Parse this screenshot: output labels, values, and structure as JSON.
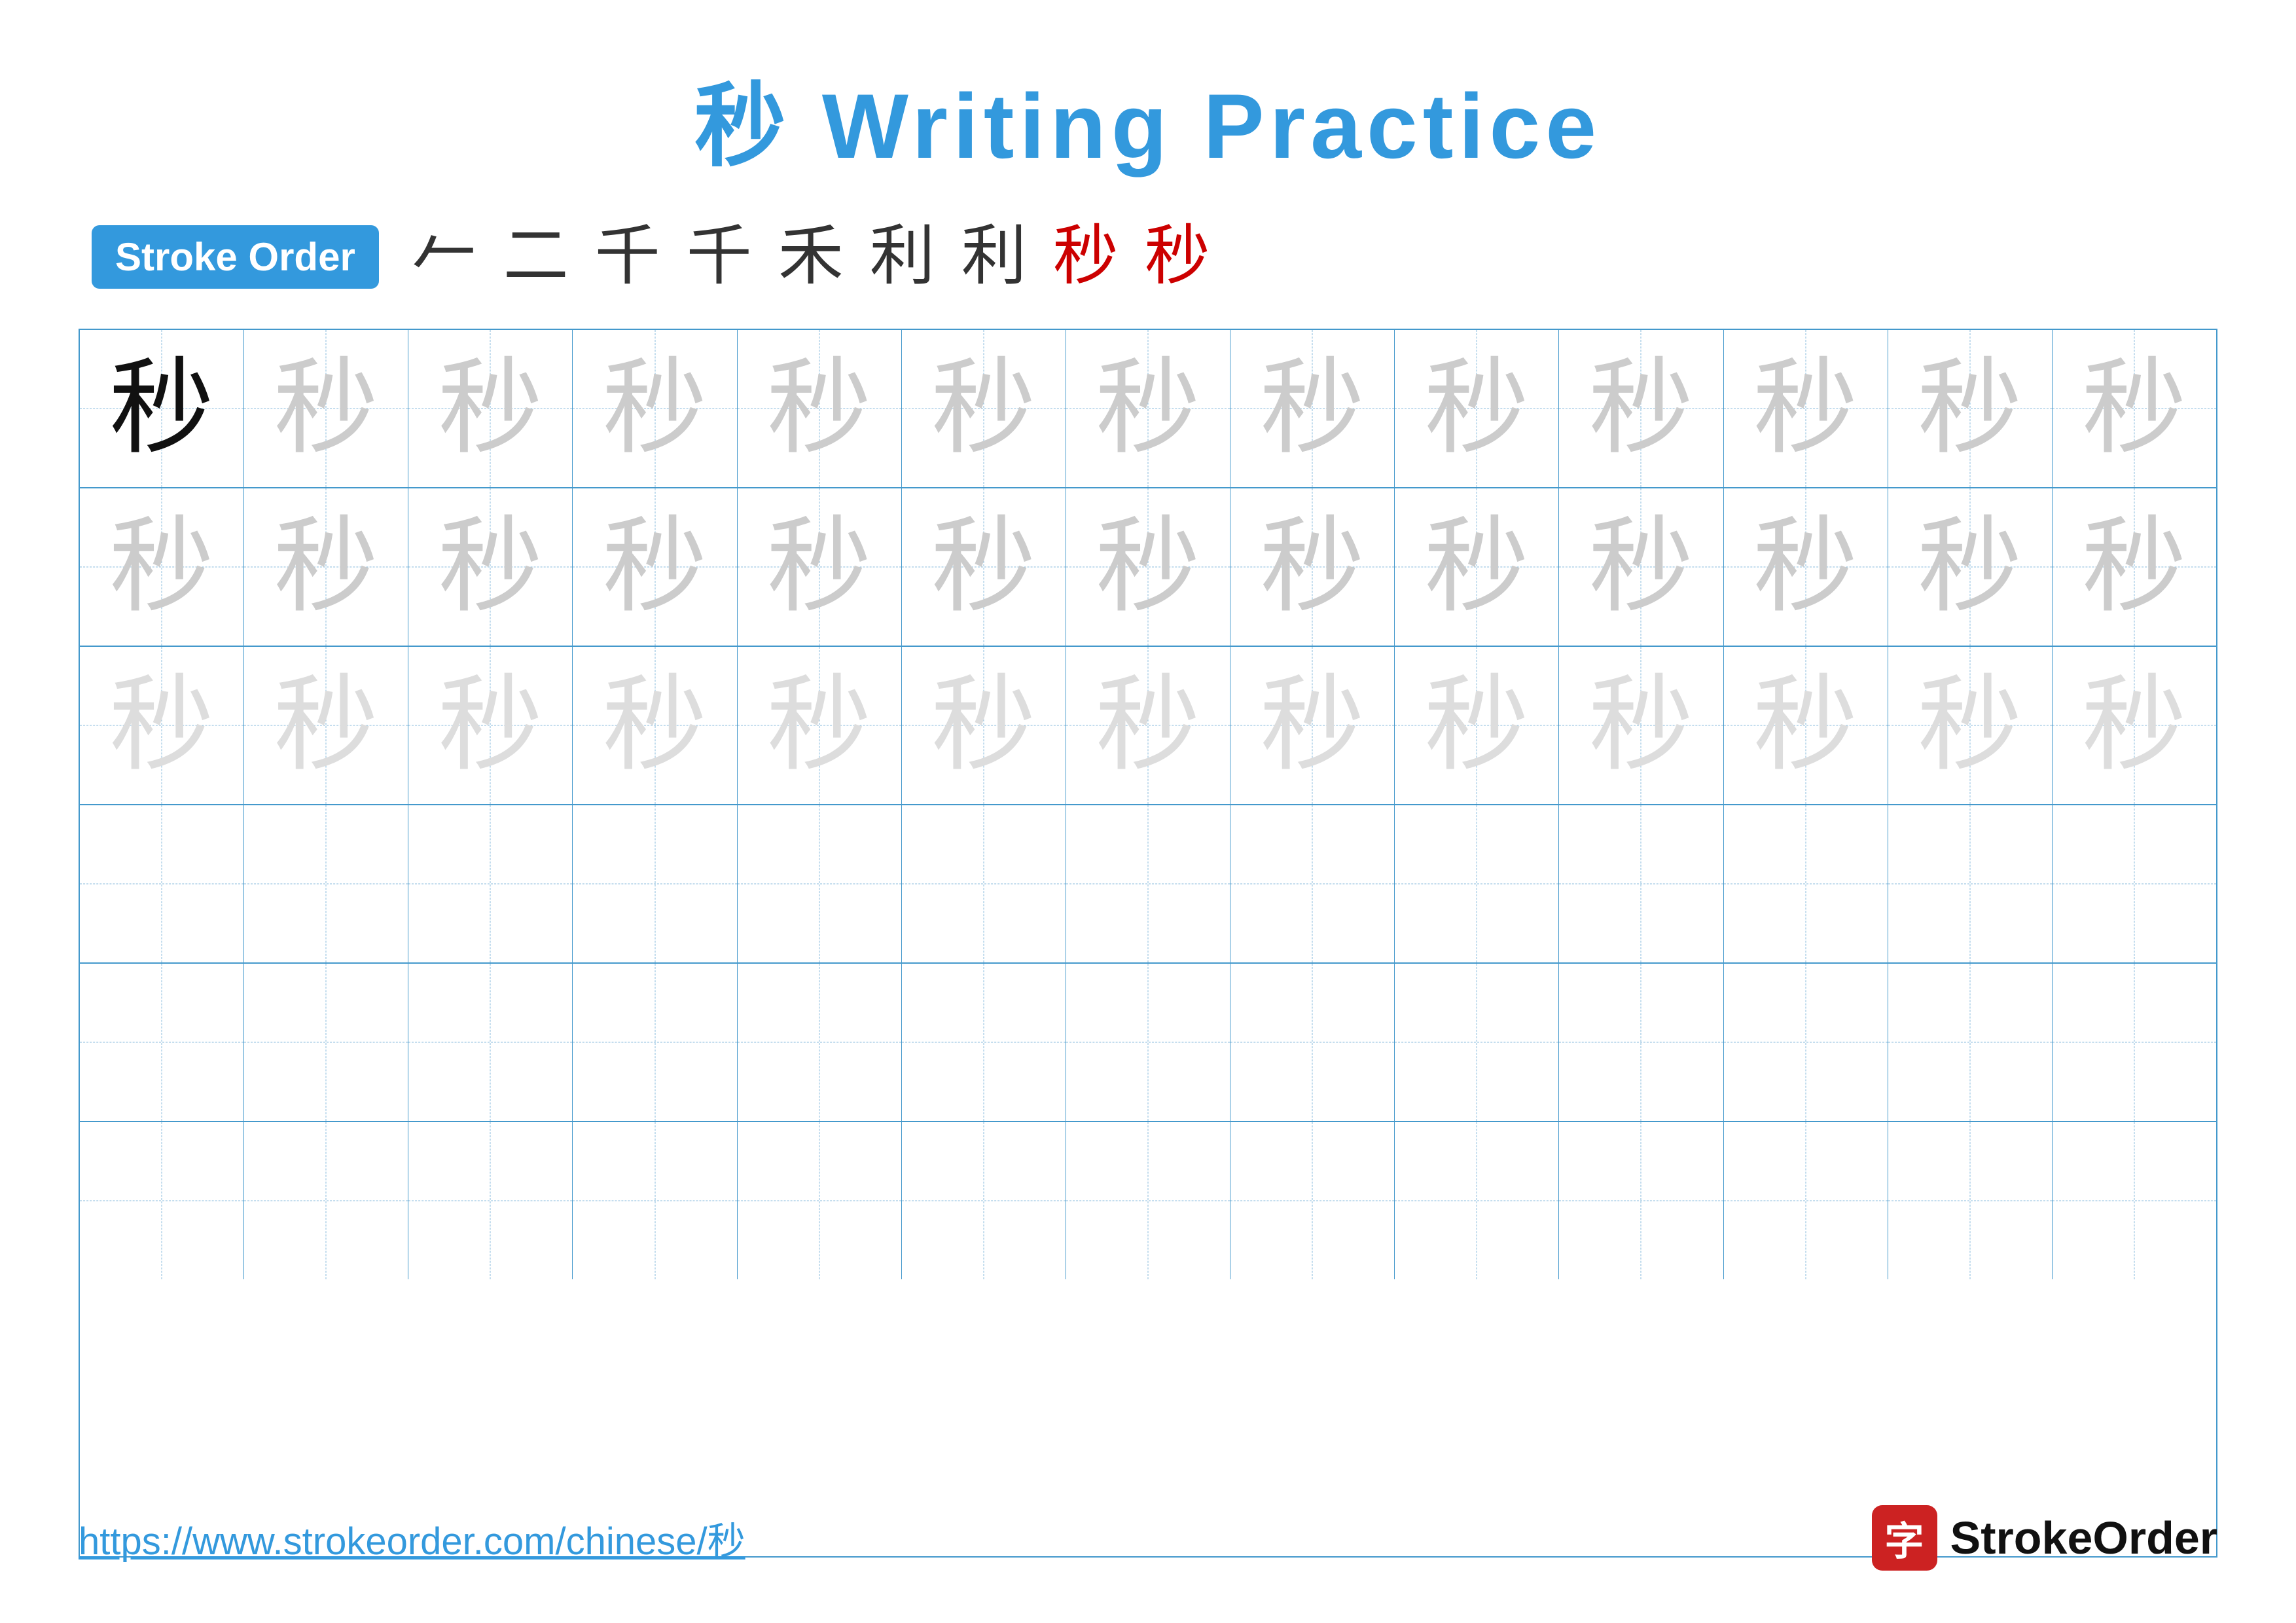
{
  "title": {
    "chinese": "秒",
    "english": "Writing Practice"
  },
  "stroke_order": {
    "badge_label": "Stroke Order",
    "steps": [
      "一",
      "二",
      "千",
      "千",
      "禾",
      "利",
      "利",
      "秒",
      "秒"
    ]
  },
  "grid": {
    "rows": 6,
    "cols": 13,
    "character": "秒",
    "row_types": [
      "solid-then-light",
      "light",
      "lighter",
      "empty",
      "empty",
      "empty"
    ]
  },
  "footer": {
    "url": "https://www.strokeorder.com/chinese/秒",
    "logo_char": "字",
    "logo_text": "StrokeOrder"
  }
}
